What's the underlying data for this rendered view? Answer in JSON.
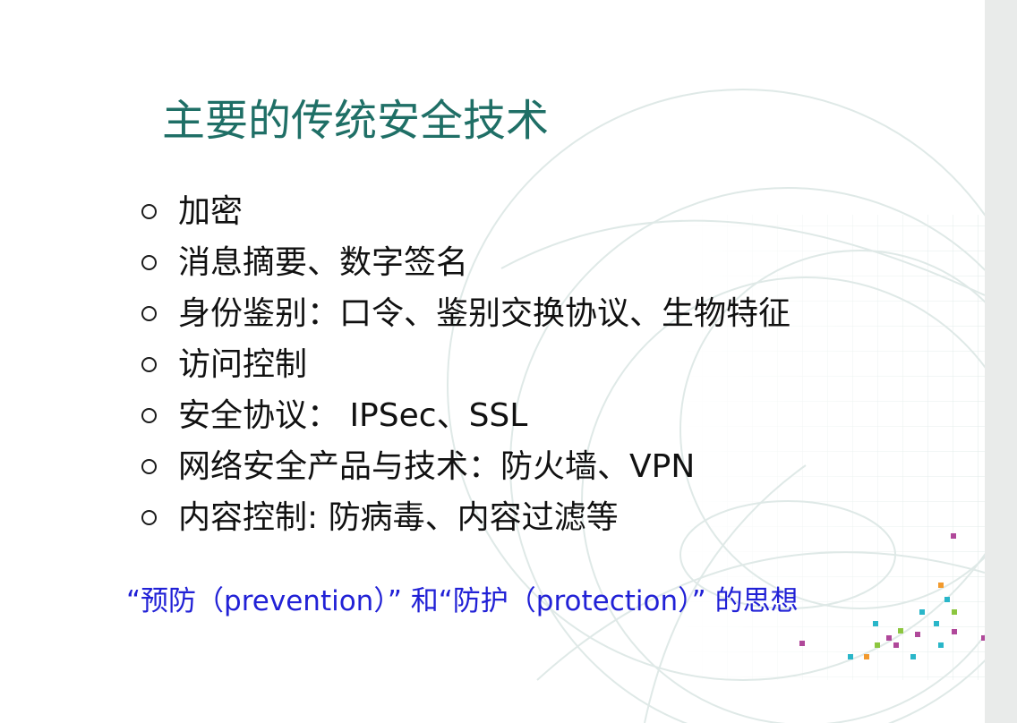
{
  "slide": {
    "title": "主要的传统安全技术",
    "bullets": [
      "加密",
      "消息摘要、数字签名",
      "身份鉴别：口令、鉴别交换协议、生物特征",
      "访问控制",
      "安全协议： IPSec、SSL",
      "网络安全产品与技术：防火墙、VPN",
      "内容控制: 防病毒、内容过滤等"
    ],
    "note": "“预防（prevention）” 和“防护（protection）” 的思想"
  },
  "colors": {
    "title": "#1f6f66",
    "bullet_text": "#111111",
    "note": "#2121d6",
    "accent_teal": "#29b6c9",
    "accent_magenta": "#b0489a",
    "accent_green": "#8cc63f",
    "accent_orange": "#f29a2e"
  }
}
